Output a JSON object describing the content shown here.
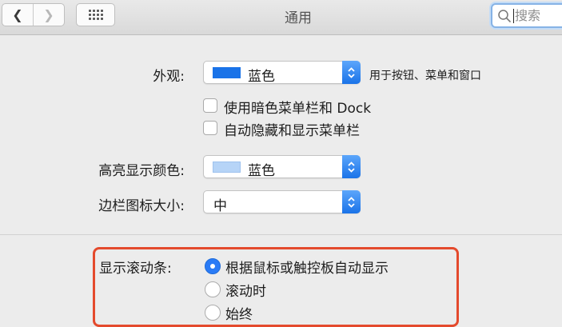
{
  "toolbar": {
    "back_icon": "chevron-left-icon",
    "forward_icon": "chevron-right-icon",
    "grid_icon": "grid-icon",
    "title": "通用",
    "search_placeholder": "搜索"
  },
  "appearance": {
    "label": "外观:",
    "value": "蓝色",
    "swatch_color": "#1a73e8",
    "hint": "用于按钮、菜单和窗口"
  },
  "checkboxes": [
    {
      "label": "使用暗色菜单栏和 Dock",
      "checked": false
    },
    {
      "label": "自动隐藏和显示菜单栏",
      "checked": false
    }
  ],
  "highlight_color": {
    "label": "高亮显示颜色:",
    "value": "蓝色",
    "swatch_color": "#b6d4f7"
  },
  "sidebar_icon_size": {
    "label": "边栏图标大小:",
    "value": "中"
  },
  "scrollbars": {
    "label": "显示滚动条:",
    "options": [
      {
        "label": "根据鼠标或触控板自动显示",
        "selected": true
      },
      {
        "label": "滚动时",
        "selected": false
      },
      {
        "label": "始终",
        "selected": false
      }
    ],
    "annotation_color": "#e44a2d"
  }
}
